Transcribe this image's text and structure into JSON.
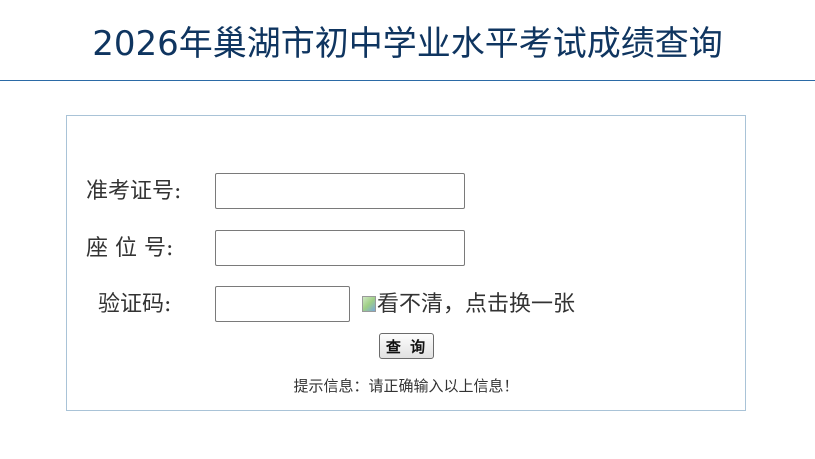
{
  "header": {
    "title": "2026年巢湖市初中学业水平考试成绩查询"
  },
  "form": {
    "exam_number_label": "准考证号:",
    "exam_number_value": "",
    "seat_label": "座 位 号:",
    "seat_value": "",
    "captcha_label": "验证码:",
    "captcha_value": "",
    "captcha_refresh_text": "看不清，点击换一张",
    "submit_label": "查 询",
    "hint": "提示信息：请正确输入以上信息！"
  }
}
